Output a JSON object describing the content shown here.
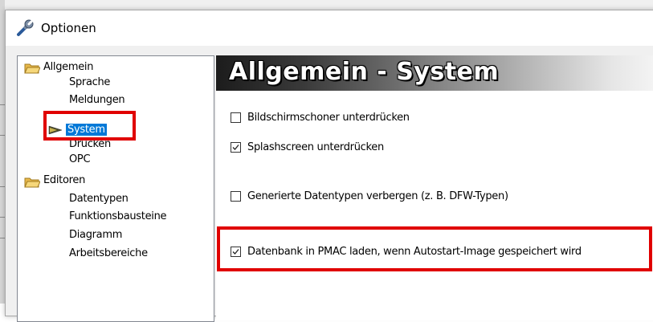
{
  "window": {
    "title": "Optionen",
    "title_icon": "wrench-icon"
  },
  "tree": {
    "items": [
      {
        "label": "Allgemein",
        "icon": "folder-open-icon"
      },
      {
        "label": "Sprache"
      },
      {
        "label": "Meldungen"
      },
      {
        "label": "System",
        "icon": "arrow-right-icon",
        "selected": true
      },
      {
        "label": "Drucken"
      },
      {
        "label": "OPC"
      },
      {
        "label": "Editoren",
        "icon": "folder-open-icon"
      },
      {
        "label": "Datentypen"
      },
      {
        "label": "Funktionsbausteine"
      },
      {
        "label": "Diagramm"
      },
      {
        "label": "Arbeitsbereiche"
      }
    ]
  },
  "panel": {
    "header": "Allgemein - System",
    "options": [
      {
        "label": "Bildschirmschoner unterdrücken",
        "checked": false
      },
      {
        "label": "Splashscreen unterdrücken",
        "checked": true
      },
      {
        "label": "Generierte Datentypen verbergen (z. B. DFW-Typen)",
        "checked": false
      },
      {
        "label": "Datenbank in PMAC laden, wenn Autostart-Image gespeichert wird",
        "checked": true
      }
    ]
  },
  "colors": {
    "highlight": "#e00000",
    "selection": "#0078d7"
  }
}
